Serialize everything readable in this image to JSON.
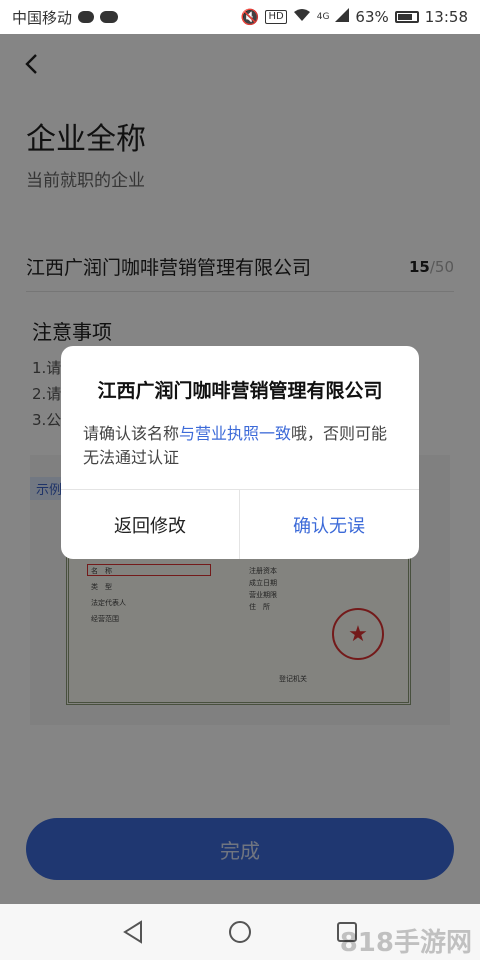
{
  "status_bar": {
    "carrier": "中国移动",
    "hd": "HD",
    "network": "4G",
    "battery": "63%",
    "time": "13:58"
  },
  "page": {
    "title": "企业全称",
    "subtitle": "当前就职的企业",
    "company_value": "江西广润门咖啡营销管理有限公司",
    "char_current": "15",
    "char_max": "/50",
    "notice_title": "注意事项",
    "notice_items": [
      "1.请",
      "2.请",
      "3.公"
    ],
    "sample_tag": "示例",
    "done_label": "完成"
  },
  "certificate": {
    "name_label": "名　称",
    "type_label": "类　型",
    "rep_label": "法定代表人",
    "scope_label": "经营范围",
    "capital_label": "注册资本",
    "date_label": "成立日期",
    "term_label": "营业期限",
    "addr_label": "住　所",
    "org_label": "登记机关"
  },
  "dialog": {
    "title": "江西广润门咖啡营销管理有限公司",
    "message_prefix": "请确认该名称",
    "message_highlight": "与营业执照一致",
    "message_suffix": "哦，否则可能无法通过认证",
    "back_label": "返回修改",
    "confirm_label": "确认无误"
  },
  "watermark": "818手游网",
  "colors": {
    "accent": "#3c6ad8"
  }
}
